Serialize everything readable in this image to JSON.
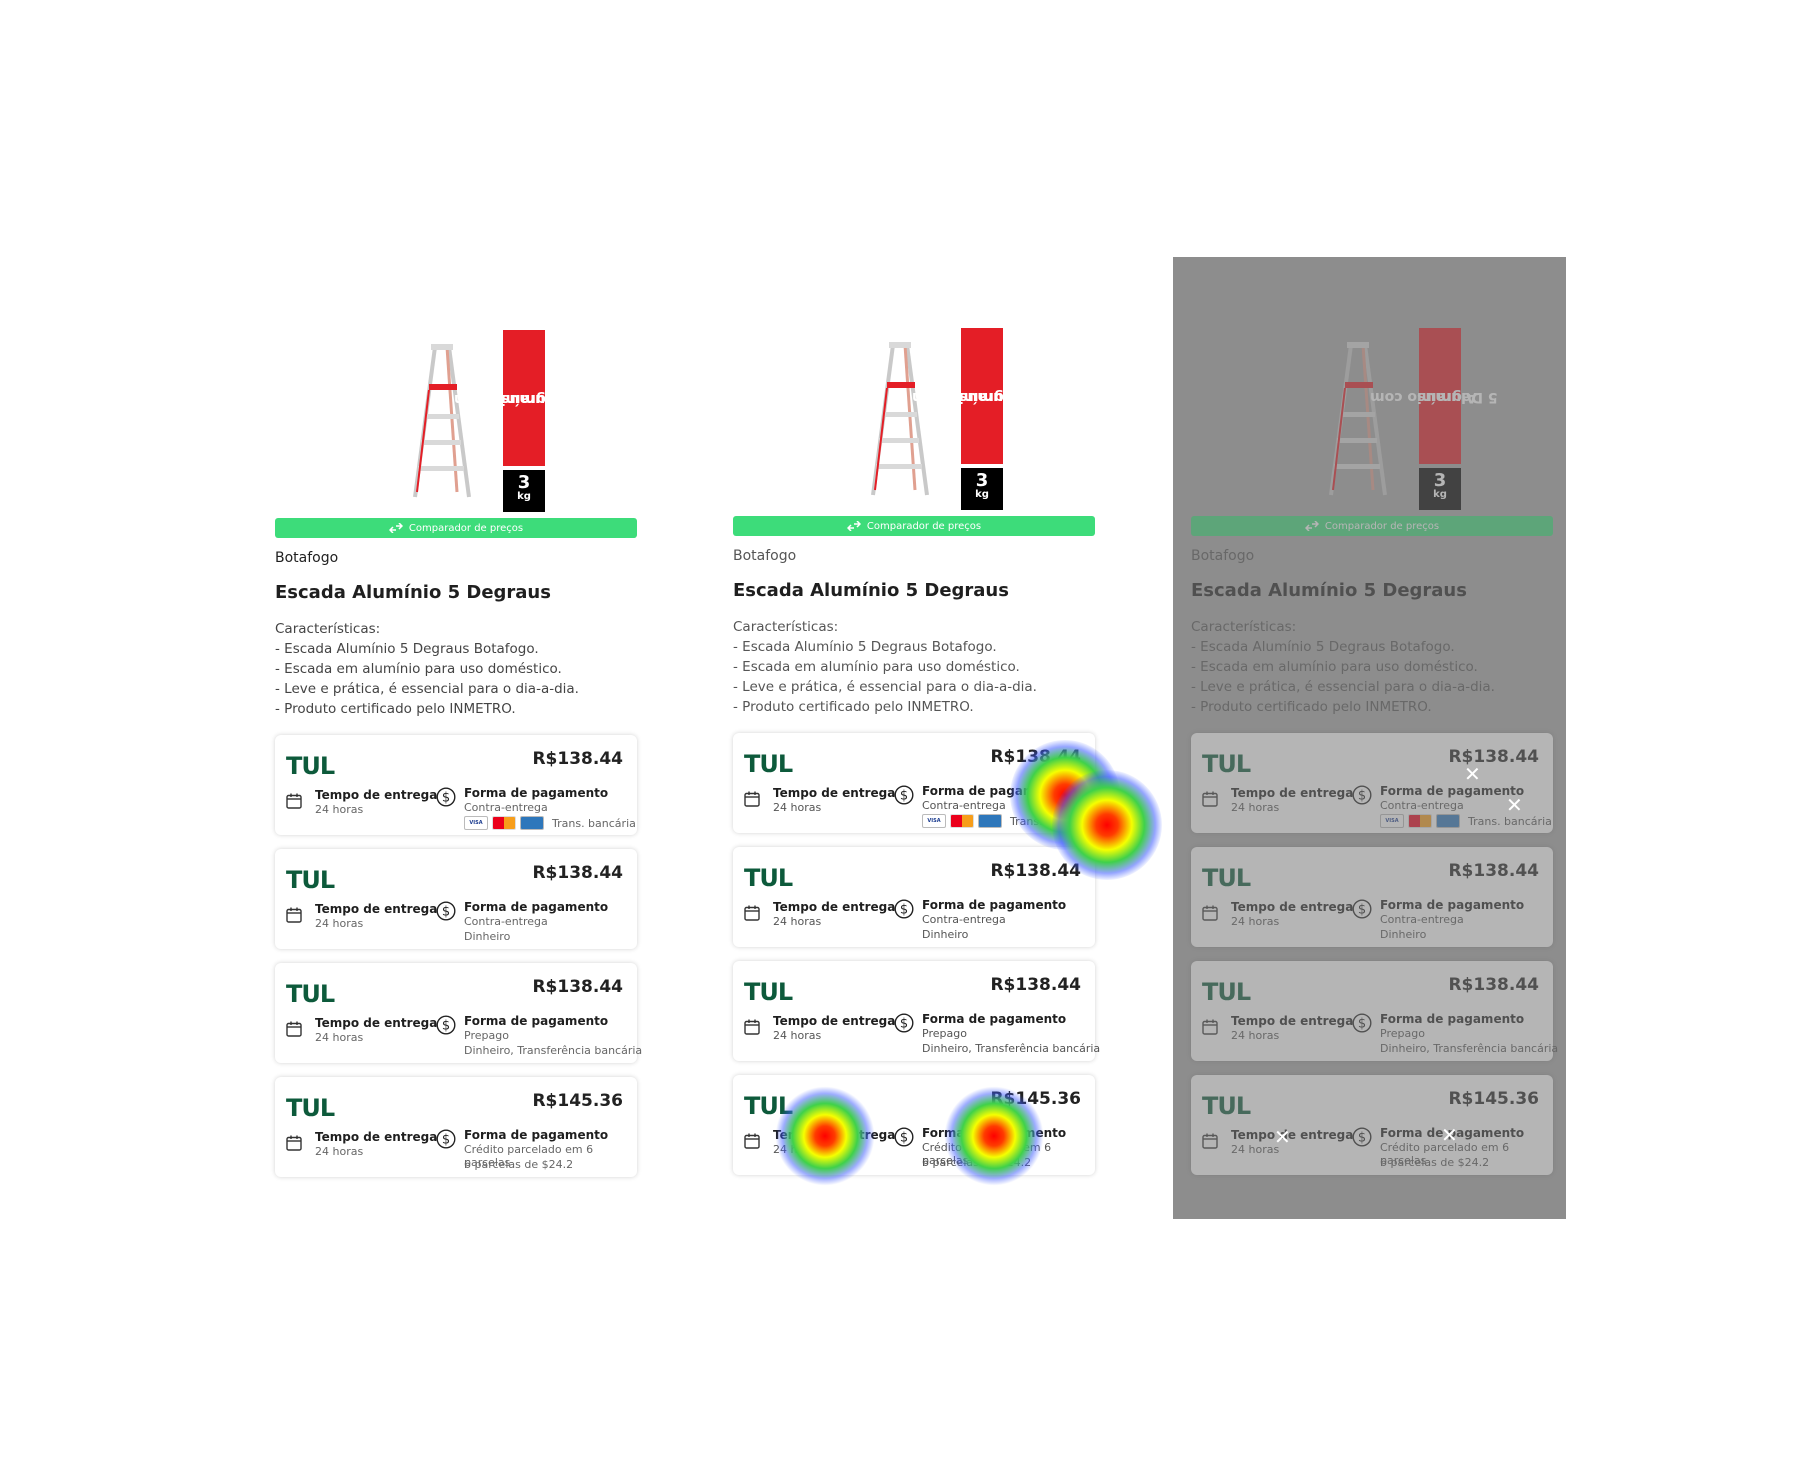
{
  "product": {
    "badge_text_line1": "Alumínio com",
    "badge_text_line2": "5 Degraus",
    "weight_value": "3",
    "weight_unit": "kg",
    "compare_label": "Comparador de preços",
    "store": "Botafogo",
    "title": "Escada Alumínio 5 Degraus",
    "features_heading": "Características:",
    "features": [
      "- Escada Alumínio 5 Degraus Botafogo.",
      "- Escada em alumínio para uso doméstico.",
      "- Leve e prática, é essencial para o dia-a-dia.",
      "- Produto certificado pelo INMETRO."
    ]
  },
  "offers": [
    {
      "logo": "TUL",
      "price": "R$138.44",
      "delivery_label": "Tempo de entrega",
      "delivery_value": "24 horas",
      "payment_label": "Forma de pagamento",
      "payment_line1": "Contra-entrega",
      "payment_line2": "Trans. bancária",
      "card_icons": [
        "VISA",
        "mastercard",
        "amex"
      ]
    },
    {
      "logo": "TUL",
      "price": "R$138.44",
      "delivery_label": "Tempo de entrega",
      "delivery_value": "24 horas",
      "payment_label": "Forma de pagamento",
      "payment_line1": "Contra-entrega",
      "payment_line2": "Dinheiro"
    },
    {
      "logo": "TUL",
      "price": "R$138.44",
      "delivery_label": "Tempo de entrega",
      "delivery_value": "24 horas",
      "payment_label": "Forma de pagamento",
      "payment_line1": "Prepago",
      "payment_line2": "Dinheiro, Transferência bancária"
    },
    {
      "logo": "TUL",
      "price": "R$145.36",
      "delivery_label": "Tempo de entrega",
      "delivery_value": "24 horas",
      "payment_label": "Forma de pagamento",
      "payment_line1": "Crédito parcelado em 6 parcelas",
      "payment_line2": "6 parcelas de $24.2"
    }
  ],
  "colors": {
    "compare_bar": "#3ddc7a",
    "brand_logo": "#0d5a3b",
    "badge_red": "#e41e26",
    "overlay_gray": "#a6a6a6"
  }
}
